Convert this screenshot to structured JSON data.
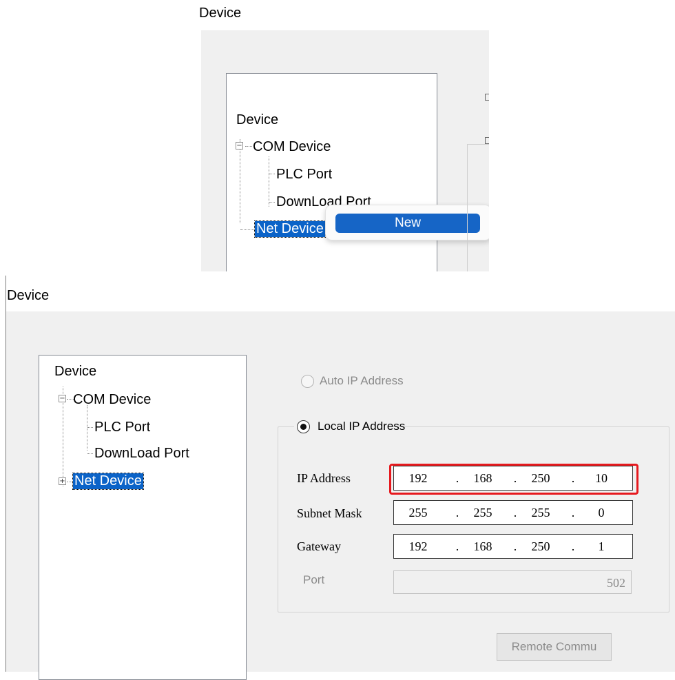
{
  "top_snippet": {
    "title": "Device",
    "tree": {
      "root": "Device",
      "com_device": "COM Device",
      "plc_port": "PLC Port",
      "download_port": "DownLoad Port",
      "net_device": "Net Device",
      "com_expander": "−"
    },
    "context_menu": {
      "new_item": "New"
    }
  },
  "bottom_snippet": {
    "title": "Device",
    "tree": {
      "root": "Device",
      "com_device": "COM Device",
      "plc_port": "PLC Port",
      "download_port": "DownLoad Port",
      "net_device": "Net Device",
      "com_expander": "−",
      "net_expander": "+"
    },
    "ip_mode": {
      "auto_label": "Auto IP Address",
      "local_label": "Local IP Address",
      "selected": "Local IP Address"
    },
    "fields": {
      "ip_address": {
        "label": "IP Address",
        "octets": [
          "192",
          "168",
          "250",
          "10"
        ],
        "separator": "."
      },
      "subnet_mask": {
        "label": "Subnet Mask",
        "octets": [
          "255",
          "255",
          "255",
          "0"
        ],
        "separator": "."
      },
      "gateway": {
        "label": "Gateway",
        "octets": [
          "192",
          "168",
          "250",
          "1"
        ],
        "separator": "."
      },
      "port": {
        "label": "Port",
        "value": "502"
      }
    },
    "remote_button": "Remote Commu"
  },
  "colors": {
    "selection": "#0b63c8",
    "highlight_border": "#e6191e",
    "panel_bg": "#f0f0f0"
  }
}
